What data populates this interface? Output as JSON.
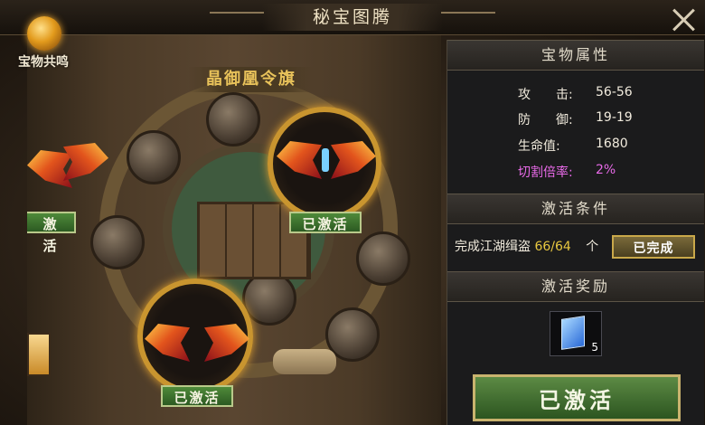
{
  "window": {
    "title": "秘宝图腾"
  },
  "resonance": {
    "label": "宝物共鸣"
  },
  "stage": {
    "section_title": "晶御凰令旗",
    "items": [
      {
        "status": "激活"
      },
      {
        "status": "已激活"
      },
      {
        "status": "已激活"
      }
    ]
  },
  "panel": {
    "attributes_header": "宝物属性",
    "stats": [
      {
        "label": "攻　　击:",
        "value": "56-56"
      },
      {
        "label": "防　　御:",
        "value": "19-19"
      },
      {
        "label": "生命值:",
        "value": "1680"
      },
      {
        "label": "切割倍率:",
        "value": "2%"
      }
    ],
    "condition_header": "激活条件",
    "condition": {
      "prefix": "完成江湖缉盗",
      "count": "66/64",
      "suffix": "个",
      "status": "已完成"
    },
    "reward_header": "激活奖励",
    "reward": {
      "icon": "skill-book-icon",
      "count": "5"
    },
    "action_button": "已激活"
  },
  "colors": {
    "accent_gold": "#c9952f",
    "activated_green": "#2c5a22",
    "stat_purple": "#e86ae8",
    "count_yellow": "#e8c840"
  }
}
